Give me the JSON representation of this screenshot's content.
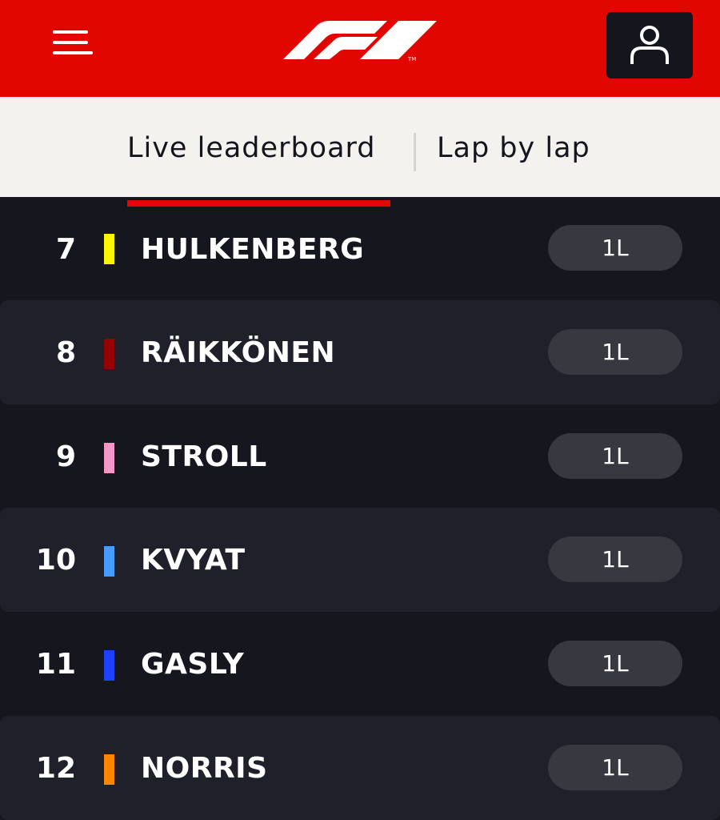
{
  "header": {
    "menu_icon": "hamburger-menu-icon",
    "logo": "F1 logo",
    "account_icon": "user-icon",
    "brand_color": "#e10600"
  },
  "tabs": [
    {
      "label": "Live leaderboard",
      "active": true
    },
    {
      "label": "Lap by lap",
      "active": false
    }
  ],
  "leaderboard": {
    "rows": [
      {
        "position": "7",
        "driver": "HULKENBERG",
        "team_color": "#fff500",
        "gap": "1L"
      },
      {
        "position": "8",
        "driver": "RÄIKKÖNEN",
        "team_color": "#960000",
        "gap": "1L"
      },
      {
        "position": "9",
        "driver": "STROLL",
        "team_color": "#f596c8",
        "gap": "1L"
      },
      {
        "position": "10",
        "driver": "KVYAT",
        "team_color": "#469bff",
        "gap": "1L"
      },
      {
        "position": "11",
        "driver": "GASLY",
        "team_color": "#1e41ff",
        "gap": "1L"
      },
      {
        "position": "12",
        "driver": "NORRIS",
        "team_color": "#ff8700",
        "gap": "1L"
      }
    ]
  }
}
